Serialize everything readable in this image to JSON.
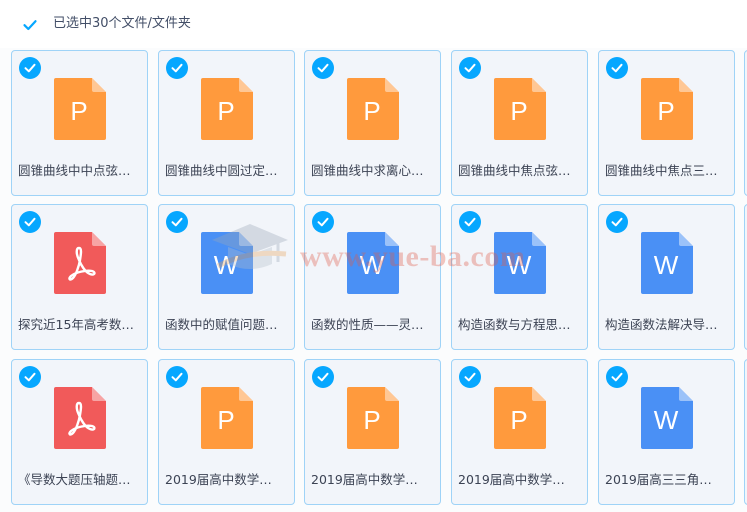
{
  "toolbar": {
    "selection_label": "已选中30个文件/文件夹",
    "select_all_checked": true
  },
  "colors": {
    "accent": "#06a7ff",
    "ppt": "#ff9a3d",
    "pdf": "#f15a5a",
    "word": "#4a90f5",
    "card_border": "#9fd3f7",
    "card_bg": "#f2f5fa"
  },
  "files": [
    {
      "name": "圆锥曲线中中点弦…",
      "type": "ppt",
      "icon": "ppt-file-icon",
      "glyph": "P",
      "selected": true
    },
    {
      "name": "圆锥曲线中圆过定…",
      "type": "ppt",
      "icon": "ppt-file-icon",
      "glyph": "P",
      "selected": true
    },
    {
      "name": "圆锥曲线中求离心…",
      "type": "ppt",
      "icon": "ppt-file-icon",
      "glyph": "P",
      "selected": true
    },
    {
      "name": "圆锥曲线中焦点弦…",
      "type": "ppt",
      "icon": "ppt-file-icon",
      "glyph": "P",
      "selected": true
    },
    {
      "name": "圆锥曲线中焦点三…",
      "type": "ppt",
      "icon": "ppt-file-icon",
      "glyph": "P",
      "selected": true
    },
    {
      "name": "探究近15年高考数…",
      "type": "pdf",
      "icon": "pdf-file-icon",
      "glyph": "",
      "selected": true
    },
    {
      "name": "函数中的赋值问题…",
      "type": "word",
      "icon": "word-file-icon",
      "glyph": "W",
      "selected": true
    },
    {
      "name": "函数的性质——灵…",
      "type": "word",
      "icon": "word-file-icon",
      "glyph": "W",
      "selected": true
    },
    {
      "name": "构造函数与方程思…",
      "type": "word",
      "icon": "word-file-icon",
      "glyph": "W",
      "selected": true
    },
    {
      "name": "构造函数法解决导…",
      "type": "word",
      "icon": "word-file-icon",
      "glyph": "W",
      "selected": true
    },
    {
      "name": "《导数大题压轴题…",
      "type": "pdf",
      "icon": "pdf-file-icon",
      "glyph": "",
      "selected": true
    },
    {
      "name": "2019届高中数学…",
      "type": "ppt",
      "icon": "ppt-file-icon",
      "glyph": "P",
      "selected": true
    },
    {
      "name": "2019届高中数学…",
      "type": "ppt",
      "icon": "ppt-file-icon",
      "glyph": "P",
      "selected": true
    },
    {
      "name": "2019届高中数学…",
      "type": "ppt",
      "icon": "ppt-file-icon",
      "glyph": "P",
      "selected": true
    },
    {
      "name": "2019届高三三角…",
      "type": "word",
      "icon": "word-file-icon",
      "glyph": "W",
      "selected": true
    }
  ],
  "watermark": {
    "text": "www.yue-ba.com"
  }
}
